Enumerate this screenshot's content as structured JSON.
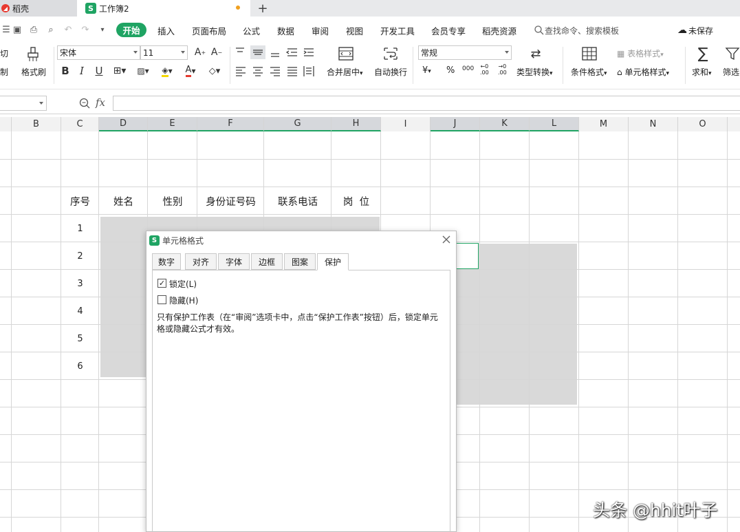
{
  "tabs": {
    "daoke": "稻壳",
    "workbook": "工作簿2",
    "new_tab": "+"
  },
  "menu": {
    "start": "开始",
    "items": [
      "插入",
      "页面布局",
      "公式",
      "数据",
      "审阅",
      "视图",
      "开发工具",
      "会员专享",
      "稻壳资源"
    ],
    "search": "查找命令、搜索模板",
    "unsaved": "未保存"
  },
  "ribbon": {
    "cut": "切",
    "copy": "制",
    "format_painter": "格式刷",
    "font": "宋体",
    "size": "11",
    "merge": "合并居中",
    "wrap": "自动换行",
    "numfmt": "常规",
    "currency": "¥",
    "percent": "%",
    "thousands": "000",
    "dec_up": ".00",
    "dec_down": ".00",
    "convert": "类型转换",
    "cond_format": "条件格式",
    "table_style": "表格样式",
    "cell_style": "单元格样式",
    "sum": "求和",
    "filter": "筛选"
  },
  "formula": {
    "fx": "fx",
    "value": ""
  },
  "columns": [
    "B",
    "C",
    "D",
    "E",
    "F",
    "G",
    "H",
    "I",
    "J",
    "K",
    "L",
    "M",
    "N",
    "O"
  ],
  "table": {
    "headers": [
      "序号",
      "姓名",
      "性别",
      "身份证号码",
      "联系电话",
      "岗  位"
    ],
    "rows": [
      "1",
      "2",
      "3",
      "4",
      "5",
      "6"
    ]
  },
  "dialog": {
    "title": "单元格格式",
    "tabs": [
      "数字",
      "对齐",
      "字体",
      "边框",
      "图案",
      "保护"
    ],
    "active_tab": "保护",
    "locked": {
      "label": "锁定(L)",
      "checked": true
    },
    "hidden": {
      "label": "隐藏(H)",
      "checked": false
    },
    "note": "只有保护工作表（在“审阅”选项卡中，点击“保护工作表”按钮）后，锁定单元格或隐藏公式才有效。"
  },
  "watermark": "头条 @hhit叶子",
  "colors": {
    "accent": "#1fa463",
    "selection_fill": "#d9d9d9",
    "header_selected": "#d6d8dc"
  }
}
